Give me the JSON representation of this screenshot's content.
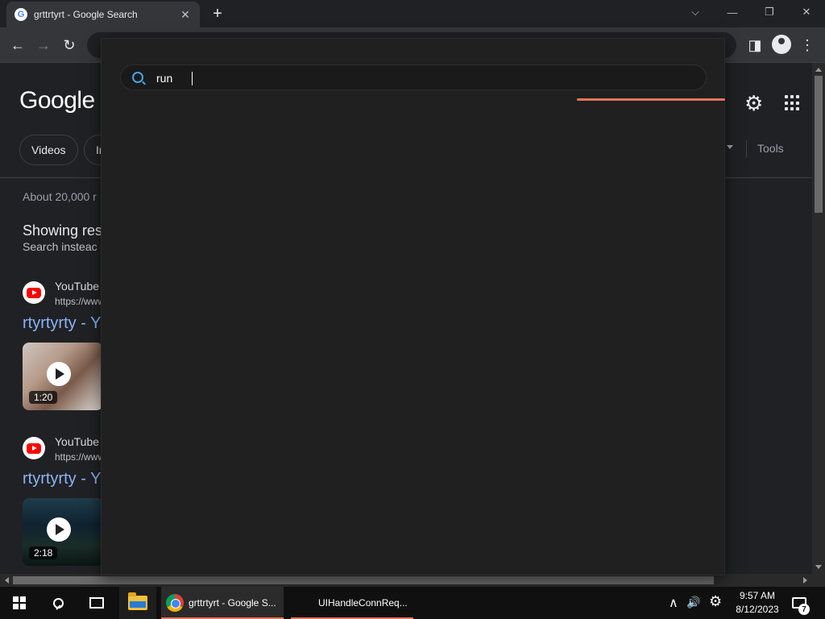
{
  "browser": {
    "tab_title": "grttrtyrt - Google Search",
    "tab_favicon": "G",
    "close_tab": "✕",
    "new_tab": "+",
    "window_controls": {
      "tab_search": "⌵",
      "minimize": "—",
      "restore": "❐",
      "close": "✕"
    },
    "toolbar": {
      "back": "←",
      "forward": "→",
      "reload": "↻",
      "bookmark": "☆",
      "side_panel": "◨",
      "menu": "⋮"
    }
  },
  "page": {
    "logo": "Google",
    "chips": [
      "Videos",
      "Ir"
    ],
    "tools_label": "Tools",
    "result_stats": "About 20,000 r",
    "showing_results": "Showing res",
    "search_instead": "Search insteac",
    "results": [
      {
        "site": "YouTube",
        "url": "https://www",
        "title": "rtyrtyrty - Y",
        "duration": "1:20"
      },
      {
        "site": "YouTube",
        "url": "https://www",
        "title": "rtyrtyrty - Y",
        "duration": "2:18"
      }
    ],
    "settings_icon": "⚙"
  },
  "overlay": {
    "query": "run",
    "accent": "#e2775a",
    "search_icon": "search-icon"
  },
  "taskbar": {
    "apps": [
      {
        "label": "grttrtyrt - Google S...",
        "icon": "chrome-icon"
      },
      {
        "label": "UIHandleConnReq...",
        "icon": ""
      }
    ],
    "tray": {
      "chevron": "∧",
      "volume": "🔊",
      "settings": "⚙",
      "time": "9:57 AM",
      "date": "8/12/2023",
      "notifications": "7"
    }
  }
}
